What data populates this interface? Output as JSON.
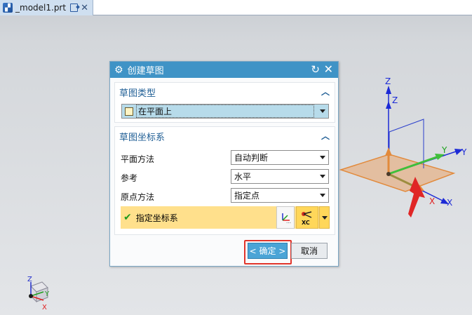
{
  "tab": {
    "title": "_model1.prt",
    "icon": "part-file-icon"
  },
  "dialog": {
    "title": "创建草图",
    "section_type": {
      "header": "草图类型",
      "value": "在平面上"
    },
    "section_csys": {
      "header": "草图坐标系",
      "plane_method_label": "平面方法",
      "plane_method_value": "自动判断",
      "reference_label": "参考",
      "reference_value": "水平",
      "origin_label": "原点方法",
      "origin_value": "指定点",
      "specify_csys_label": "指定坐标系"
    },
    "ok_label": "< 确定 >",
    "cancel_label": "取消"
  },
  "triad": {
    "z": "Z",
    "y": "Y",
    "x": "X",
    "zc": "Z",
    "yc": "Y",
    "xc": "X",
    "xc_icon": "XC"
  },
  "mini_triad": {
    "z": "Z",
    "y": "Y",
    "x": "X"
  },
  "colors": {
    "title_bar": "#3f93c6",
    "highlight": "#ffe08c",
    "section_text": "#1f5e95",
    "ok_button": "#4aa4d6",
    "ok_highlight_box": "#e0342a",
    "plane_fill": "#e9a46b"
  }
}
